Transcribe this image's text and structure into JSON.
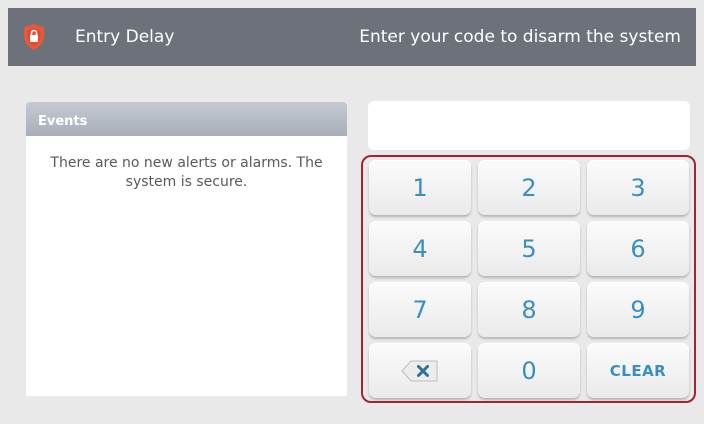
{
  "header": {
    "status_title": "Entry Delay",
    "instruction": "Enter your code to disarm the system",
    "badge_icon": "shield-lock-icon",
    "badge_color": "#e8583a"
  },
  "events": {
    "header_label": "Events",
    "message": "There are no new alerts or alarms. The system is secure."
  },
  "code_entry": {
    "value": ""
  },
  "keypad": {
    "keys": [
      "1",
      "2",
      "3",
      "4",
      "5",
      "6",
      "7",
      "8",
      "9"
    ],
    "backspace_icon": "backspace-icon",
    "zero": "0",
    "clear": "CLEAR",
    "accent_color": "#3b8fc0",
    "highlight_border": "#a32330"
  }
}
